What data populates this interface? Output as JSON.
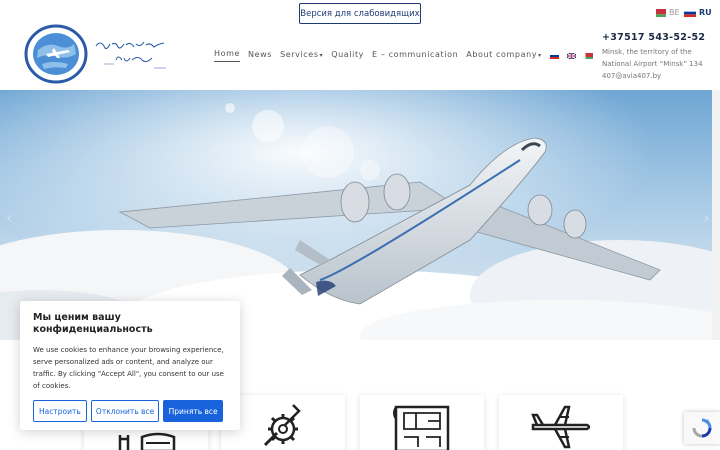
{
  "accessibility": {
    "low_vision_label": "Версия для слабовидящих"
  },
  "languages_top": [
    {
      "code": "BE",
      "flag": "belarus-flag"
    },
    {
      "code": "RU",
      "flag": "russia-flag",
      "active": true
    }
  ],
  "nav": {
    "items": [
      {
        "label": "Home",
        "active": true
      },
      {
        "label": "News"
      },
      {
        "label": "Services",
        "dropdown": true
      },
      {
        "label": "Quality"
      },
      {
        "label": "E – communication"
      },
      {
        "label": "About company",
        "dropdown": true
      }
    ],
    "dropdown_caret": "▾",
    "lang_flags": [
      "russia-flag",
      "uk-flag",
      "belarus-flag"
    ]
  },
  "contact": {
    "phone": "+37517 543-52-52",
    "address": "Minsk, the territory of the National Airport “Minsk” 134",
    "email": "407@avia407.by"
  },
  "hero": {
    "prev_arrow": "‹",
    "next_arrow": "›"
  },
  "cards": [
    {
      "icon": "building-icon"
    },
    {
      "icon": "gear-wrench-icon"
    },
    {
      "icon": "blueprint-icon"
    },
    {
      "icon": "airplane-icon"
    }
  ],
  "cookie": {
    "title": "Мы ценим вашу конфиденциальность",
    "body": "We use cookies to enhance your browsing experience, serve personalized ads or content, and analyze our traffic. By clicking \"Accept All\", you consent to our use of cookies.",
    "customize_label": "Настроить",
    "reject_label": "Отклонить все",
    "accept_label": "Принять все"
  },
  "colors": {
    "brand_blue": "#1f3b73",
    "cookie_blue": "#1863dc",
    "sky": "#9ec3e0"
  }
}
